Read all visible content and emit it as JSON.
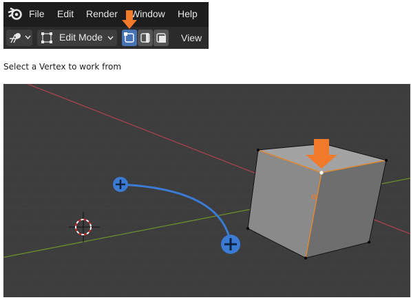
{
  "menu": {
    "items": [
      "File",
      "Edit",
      "Render",
      "Window",
      "Help"
    ]
  },
  "toolbar": {
    "mode_label": "Edit Mode",
    "view_label": "View",
    "select_modes": [
      "vertex-select",
      "edge-select",
      "face-select"
    ],
    "active_select_mode": "vertex-select"
  },
  "instruction": {
    "text": "Select a Vertex to work from"
  },
  "colors": {
    "arrow": "#f07a2a",
    "active_button": "#4772b3",
    "curve": "#3b7bd4",
    "x_axis": "#a84250",
    "y_axis": "#6f8f2e"
  }
}
